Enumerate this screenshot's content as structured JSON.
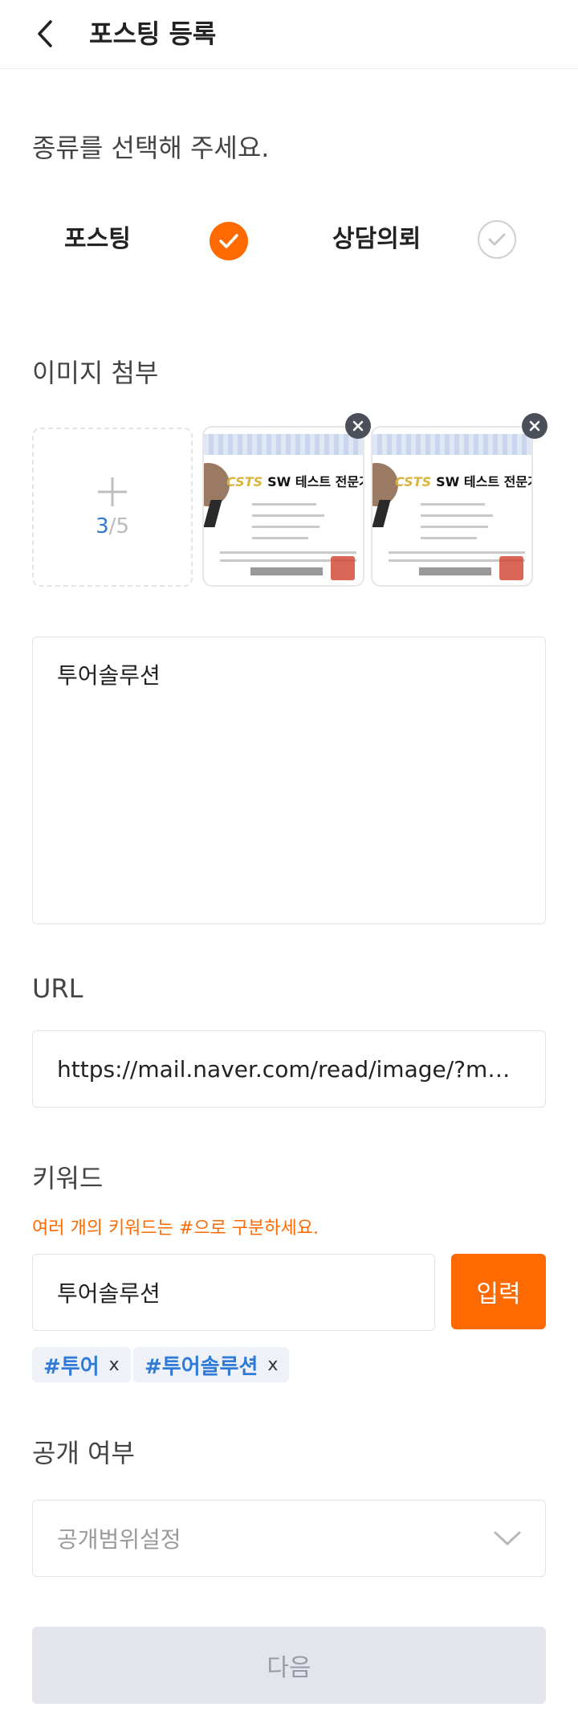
{
  "header": {
    "title": "포스팅 등록"
  },
  "type_section": {
    "label": "종류를 선택해 주세요.",
    "options": [
      {
        "label": "포스팅",
        "selected": true
      },
      {
        "label": "상담의뢰",
        "selected": false
      }
    ]
  },
  "image_section": {
    "label": "이미지 첨부",
    "count_current": "3",
    "count_separator": "/",
    "count_max": "5",
    "thumbnails": [
      {
        "title_brand": "CSTS",
        "title_text": "SW 테스트 전문가 자격"
      },
      {
        "title_brand": "CSTS",
        "title_text": "SW 테스트 전문가 자격"
      }
    ]
  },
  "content": {
    "value": "투어솔루션"
  },
  "url_section": {
    "label": "URL",
    "value": "https://mail.naver.com/read/image/?mailSN=..."
  },
  "keyword_section": {
    "label": "키워드",
    "hint": "여러 개의 키워드는 #으로 구분하세요.",
    "input_value": "투어솔루션",
    "submit_label": "입력",
    "tags": [
      {
        "text": "#투어",
        "remove": "x"
      },
      {
        "text": "#투어솔루션",
        "remove": "x"
      }
    ]
  },
  "visibility_section": {
    "label": "공개 여부",
    "placeholder": "공개범위설정"
  },
  "footer": {
    "next_label": "다음"
  },
  "colors": {
    "accent": "#ff6a00",
    "tag_text": "#2f7ad6",
    "disabled_bg": "#e3e4ec"
  }
}
